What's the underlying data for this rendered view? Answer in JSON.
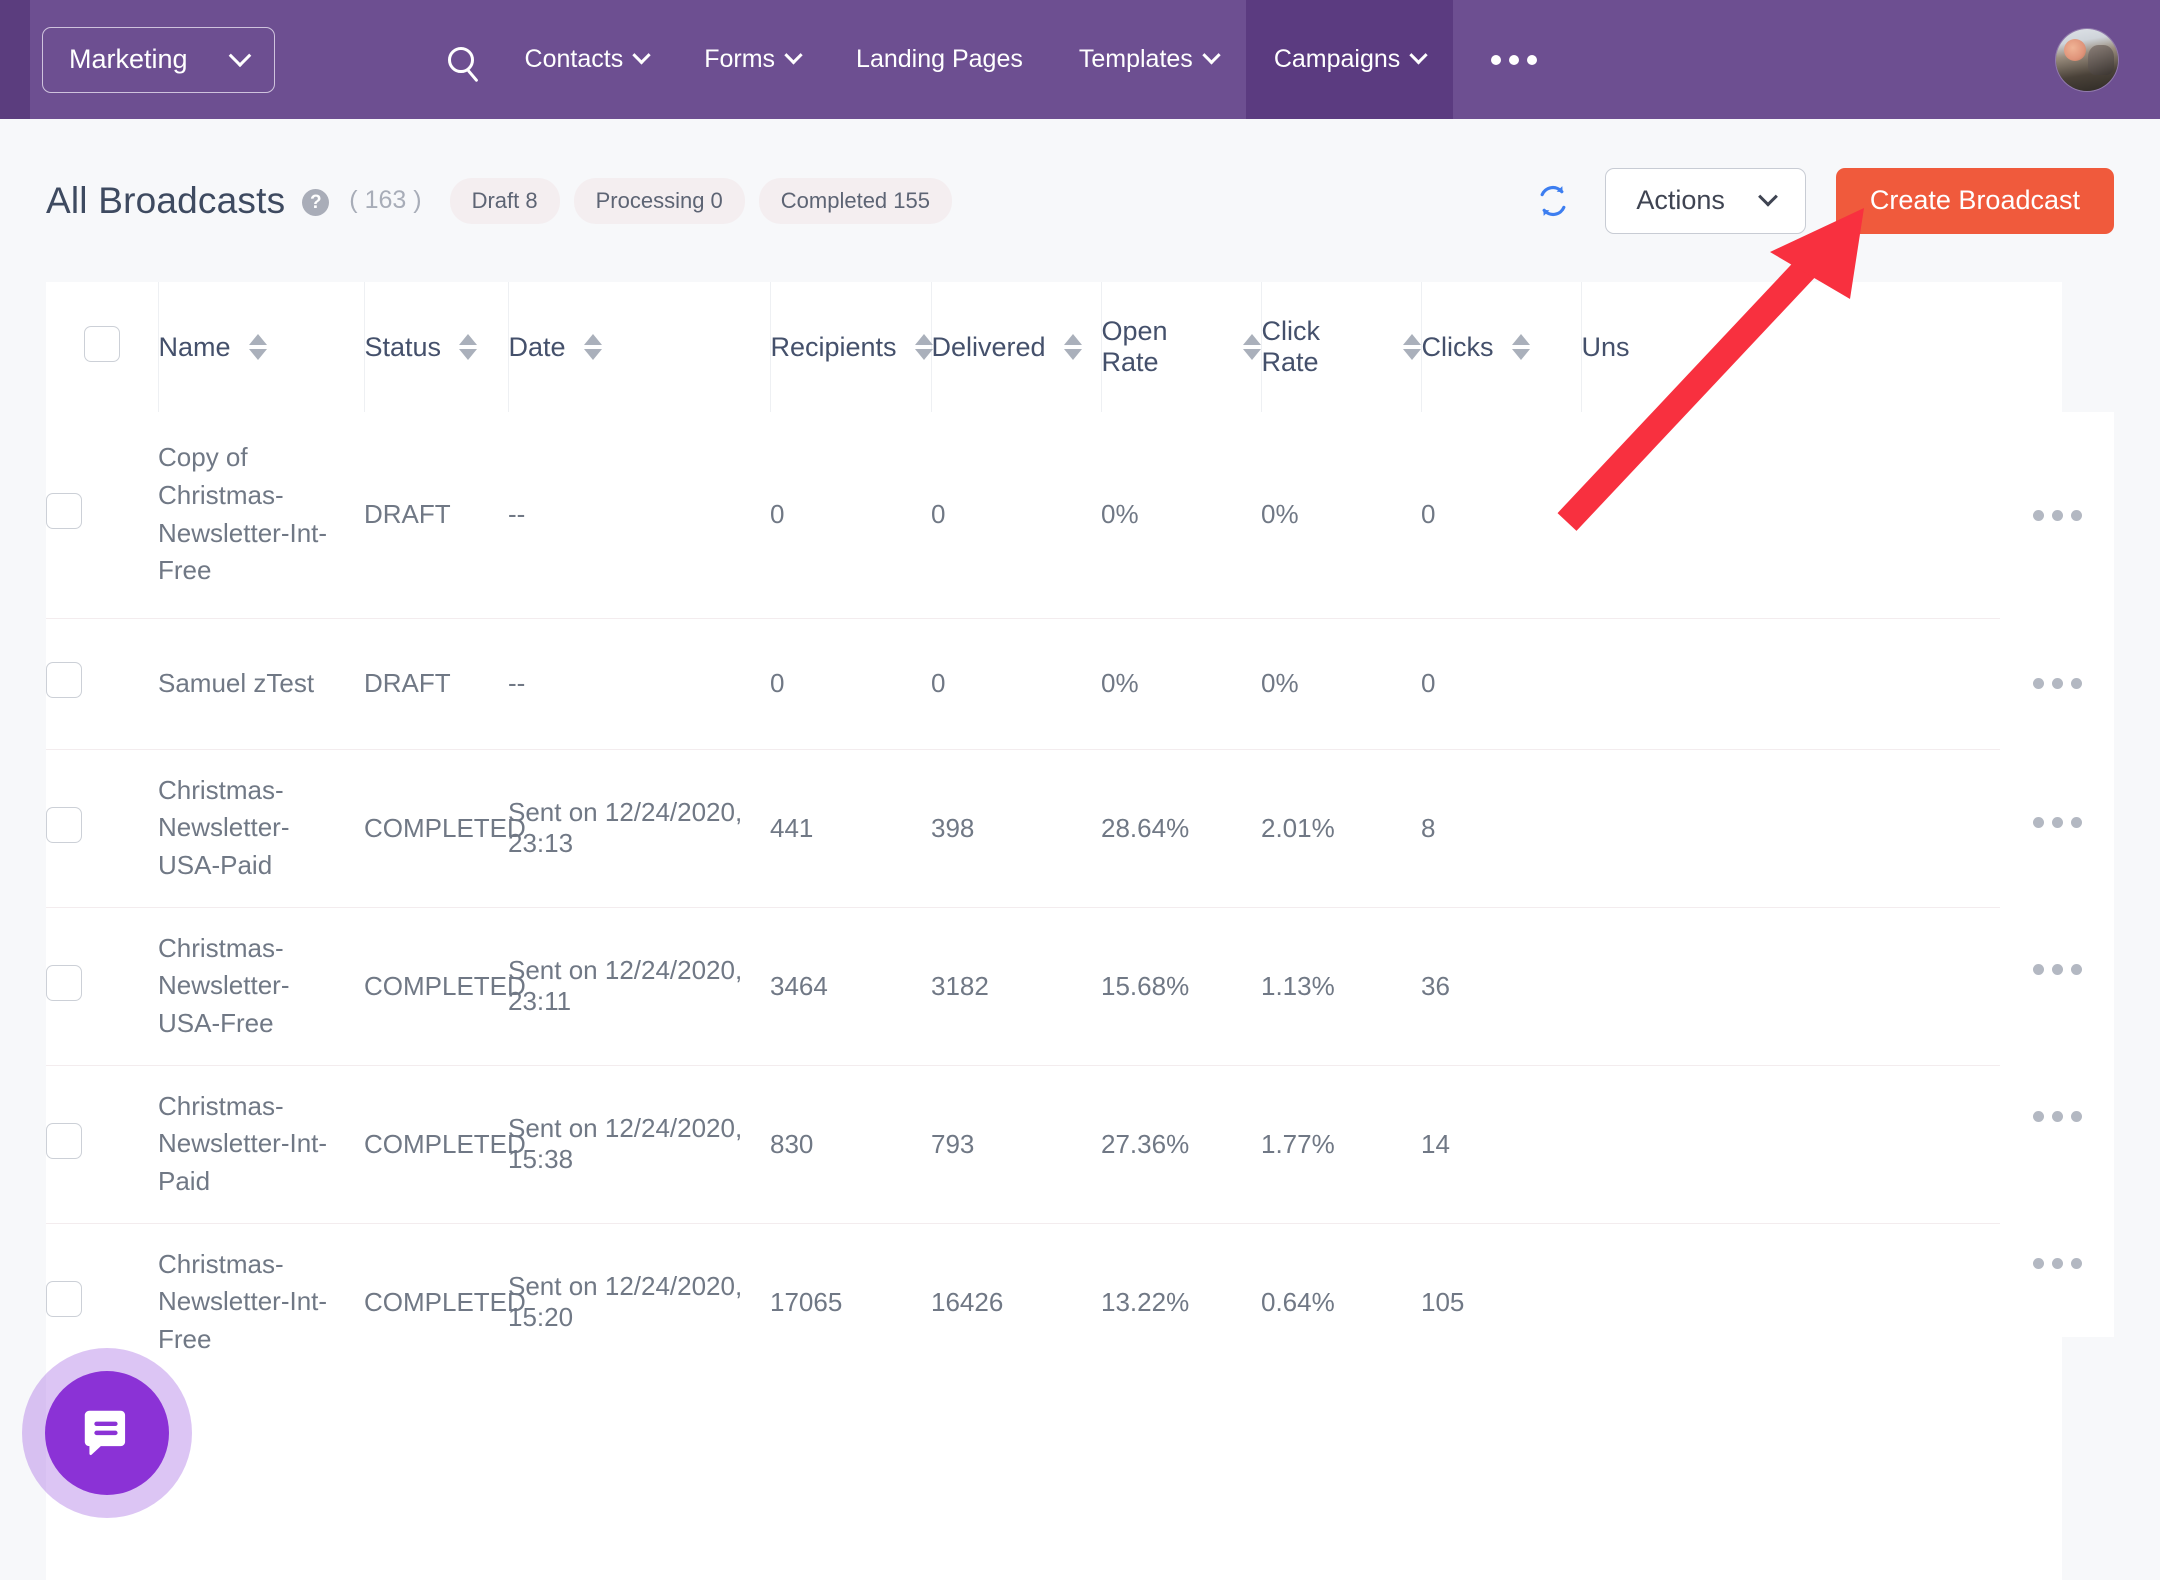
{
  "topnav": {
    "brand": {
      "label": "Marketing",
      "icon": "chevron-down-icon"
    },
    "search_icon": "search-icon",
    "items": [
      {
        "label": "Contacts",
        "has_caret": true,
        "active": false
      },
      {
        "label": "Forms",
        "has_caret": true,
        "active": false
      },
      {
        "label": "Landing Pages",
        "has_caret": false,
        "active": false
      },
      {
        "label": "Templates",
        "has_caret": true,
        "active": false
      },
      {
        "label": "Campaigns",
        "has_caret": true,
        "active": true
      }
    ],
    "overflow_icon": "ellipsis-icon",
    "avatar_icon": "user-avatar",
    "bg_color": "#6d4f91",
    "active_bg_color": "#5b3b80"
  },
  "header": {
    "title": "All Broadcasts",
    "help_icon": "question-mark-icon",
    "count": "( 163 )",
    "pills": [
      {
        "label": "Draft 8"
      },
      {
        "label": "Processing 0"
      },
      {
        "label": "Completed 155"
      }
    ],
    "refresh_icon": "refresh-icon",
    "actions_label": "Actions",
    "actions_caret": "chevron-down-icon",
    "create_label": "Create Broadcast",
    "create_color": "#f05a3c"
  },
  "table": {
    "select_all": "",
    "columns": [
      {
        "key": "name",
        "label": "Name",
        "sortable": true
      },
      {
        "key": "status",
        "label": "Status",
        "sortable": true
      },
      {
        "key": "date",
        "label": "Date",
        "sortable": true
      },
      {
        "key": "recipients",
        "label": "Recipients",
        "sortable": true
      },
      {
        "key": "delivered",
        "label": "Delivered",
        "sortable": true
      },
      {
        "key": "open_rate",
        "label": "Open Rate",
        "sortable": true
      },
      {
        "key": "click_rate",
        "label": "Click Rate",
        "sortable": true
      },
      {
        "key": "clicks",
        "label": "Clicks",
        "sortable": true
      },
      {
        "key": "unsubscribes",
        "label": "Uns",
        "sortable": false
      }
    ],
    "rows": [
      {
        "name": "Copy of Christmas-Newsletter-Int-Free",
        "status": "DRAFT",
        "date": "--",
        "recipients": "0",
        "delivered": "0",
        "open_rate": "0%",
        "click_rate": "0%",
        "clicks": "0",
        "unsubscribes": ""
      },
      {
        "name": "Samuel zTest",
        "status": "DRAFT",
        "date": "--",
        "recipients": "0",
        "delivered": "0",
        "open_rate": "0%",
        "click_rate": "0%",
        "clicks": "0",
        "unsubscribes": ""
      },
      {
        "name": "Christmas-Newsletter-USA-Paid",
        "status": "COMPLETED",
        "date": "Sent on 12/24/2020, 23:13",
        "recipients": "441",
        "delivered": "398",
        "open_rate": "28.64%",
        "click_rate": "2.01%",
        "clicks": "8",
        "unsubscribes": ""
      },
      {
        "name": "Christmas-Newsletter-USA-Free",
        "status": "COMPLETED",
        "date": "Sent on 12/24/2020, 23:11",
        "recipients": "3464",
        "delivered": "3182",
        "open_rate": "15.68%",
        "click_rate": "1.13%",
        "clicks": "36",
        "unsubscribes": ""
      },
      {
        "name": "Christmas-Newsletter-Int-Paid",
        "status": "COMPLETED",
        "date": "Sent on 12/24/2020, 15:38",
        "recipients": "830",
        "delivered": "793",
        "open_rate": "27.36%",
        "click_rate": "1.77%",
        "clicks": "14",
        "unsubscribes": ""
      },
      {
        "name": "Christmas-Newsletter-Int-Free",
        "status": "COMPLETED",
        "date": "Sent on 12/24/2020, 15:20",
        "recipients": "17065",
        "delivered": "16426",
        "open_rate": "13.22%",
        "click_rate": "0.64%",
        "clicks": "105",
        "unsubscribes": ""
      }
    ],
    "row_menu_icon": "ellipsis-icon"
  },
  "annotation": {
    "type": "arrow",
    "color": "#f8303f",
    "points_to": "Create Broadcast"
  },
  "chat": {
    "icon": "chat-bubble-icon",
    "color": "#8b32d6"
  }
}
